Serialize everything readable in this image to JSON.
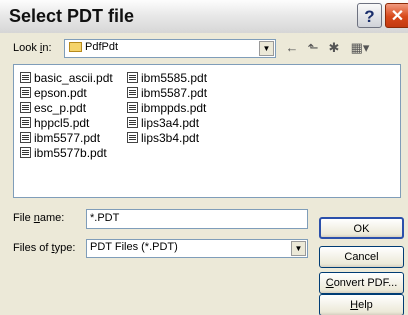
{
  "window": {
    "title": "Select PDT file",
    "help_glyph": "?",
    "close_glyph": "✕"
  },
  "look_in": {
    "label_pre": "Look ",
    "label_u": "i",
    "label_post": "n:",
    "value": "PdfPdt",
    "folder_icon": "folder-icon"
  },
  "nav": {
    "back": "←",
    "up": "⬑",
    "new_folder": "✱",
    "view_menu": "▦▾"
  },
  "files": [
    "basic_ascii.pdt",
    "epson.pdt",
    "esc_p.pdt",
    "hppcl5.pdt",
    "ibm5577.pdt",
    "ibm5577b.pdt",
    "ibm5585.pdt",
    "ibm5587.pdt",
    "ibmppds.pdt",
    "lips3a4.pdt",
    "lips3b4.pdt"
  ],
  "file_name": {
    "label_pre": "File ",
    "label_u": "n",
    "label_post": "ame:",
    "value": "*.PDT"
  },
  "file_type": {
    "label_pre": "Files of ",
    "label_u": "t",
    "label_post": "ype:",
    "value": "PDT Files (*.PDT)"
  },
  "buttons": {
    "ok": "OK",
    "cancel": "Cancel",
    "convert_u": "C",
    "convert_rest": "onvert PDF...",
    "help_u": "H",
    "help_rest": "elp"
  }
}
